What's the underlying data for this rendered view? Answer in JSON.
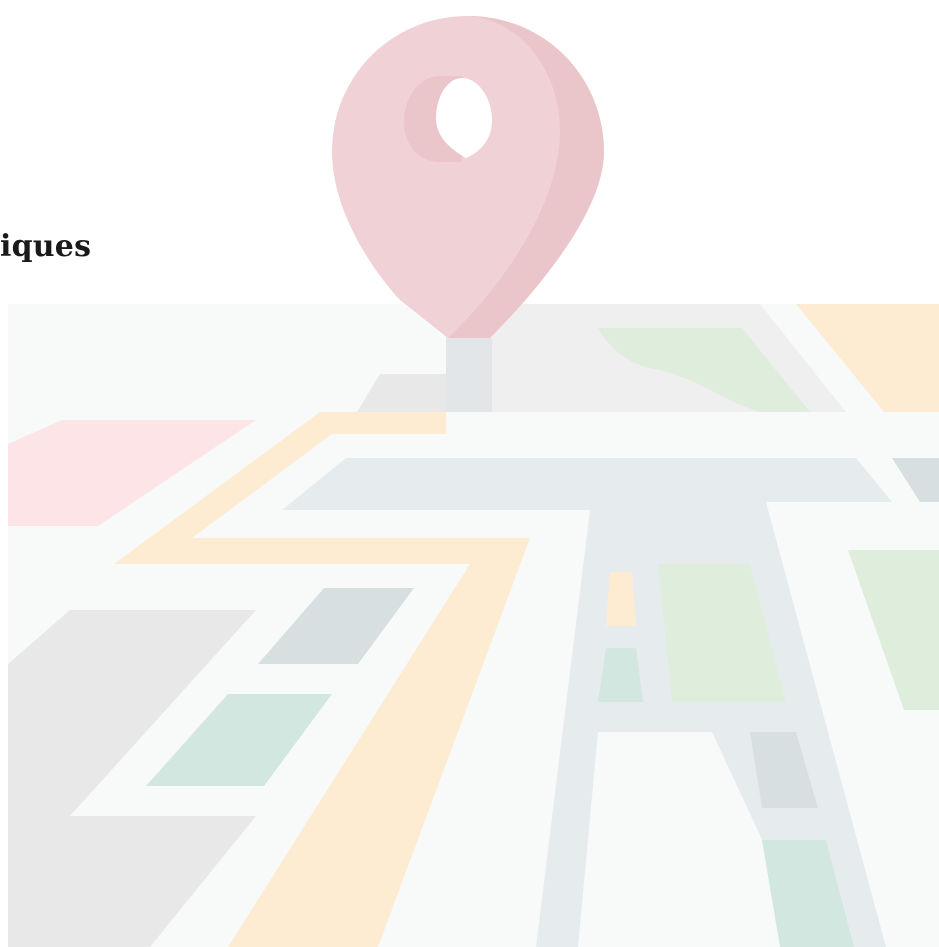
{
  "heading": {
    "fragment": "iques"
  },
  "illustration": {
    "icon": "map-pin-icon",
    "colors": {
      "pin": "#f0d1d5",
      "pin_shade": "#eac6cb",
      "road_light": "#e6ecee",
      "road_yellow": "#fdecd2",
      "green_block": "#dfeddc",
      "teal_block": "#d2e7e0",
      "gray_block": "#d8dfe1",
      "light_gray_block": "#e8e8e8",
      "pink_block": "#fde4e6",
      "ground": "#f8f9f9"
    }
  }
}
